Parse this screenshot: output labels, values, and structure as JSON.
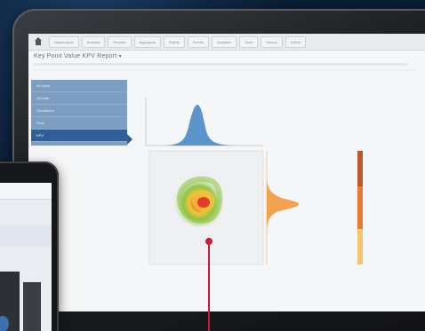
{
  "report": {
    "title": "Key Point Value KPV Report"
  },
  "nav": {
    "tabs": [
      "Dashboards",
      "Analysis",
      "Reports",
      "Aggregate",
      "Flights",
      "Events",
      "Analytics",
      "Tools",
      "Search",
      "Admin"
    ]
  },
  "sidebar": {
    "items": [
      {
        "label": "All Items"
      },
      {
        "label": "All Data"
      },
      {
        "label": "Operations"
      },
      {
        "label": "Fleet"
      },
      {
        "label": "KPV"
      }
    ]
  },
  "chart_data": {
    "type": "heatmap",
    "description_marks": [
      "density-contour",
      "top-marginal-distribution",
      "right-marginal-distribution",
      "colorbar"
    ],
    "colors": {
      "marginal_top": "#4b89c6",
      "marginal_right": "#f39a3c",
      "heat_high": "#e0262a",
      "heat_mid": "#f2c43a",
      "heat_low": "#8fc447"
    }
  },
  "accent_colors": {
    "sidebar": "#7d9ec1",
    "sidebar_active": "#2f5f94",
    "annotation": "#c21f3a"
  }
}
